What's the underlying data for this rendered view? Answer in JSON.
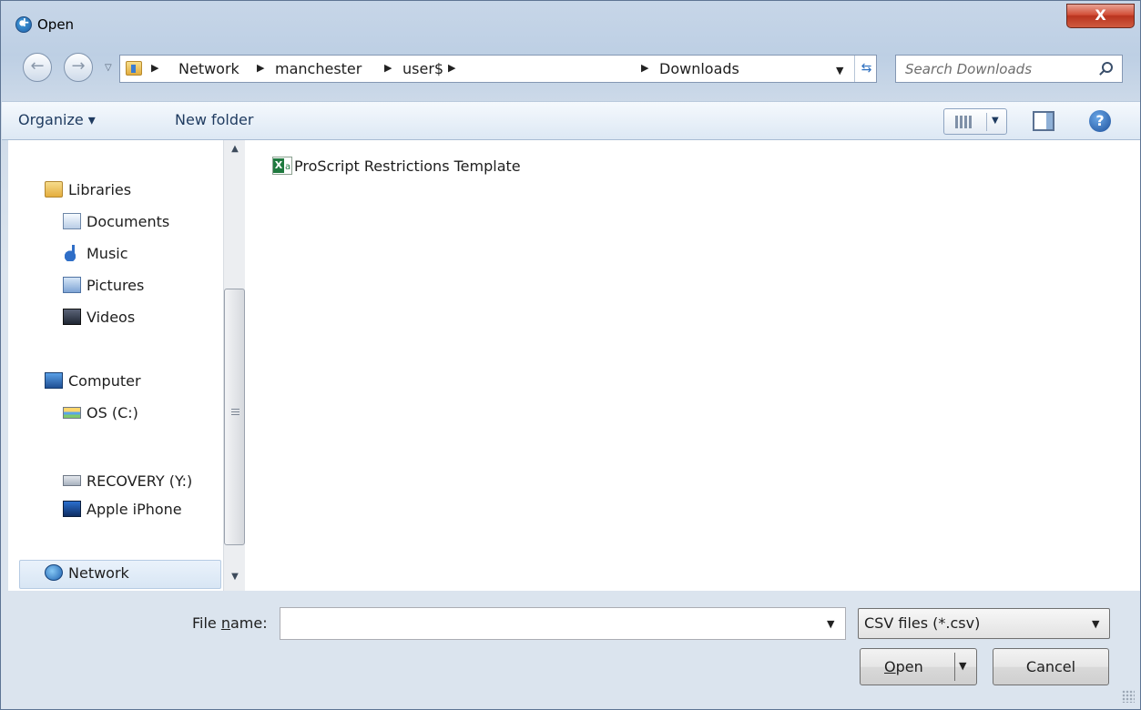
{
  "window": {
    "title": "Open",
    "close_label": "X"
  },
  "address_bar": {
    "crumbs": [
      "Network",
      "manchester",
      "user$",
      "Downloads"
    ]
  },
  "search": {
    "placeholder": "Search Downloads"
  },
  "toolbar": {
    "organize_label": "Organize ▾",
    "new_folder_label": "New folder"
  },
  "nav_pane": {
    "items": [
      {
        "label": "Libraries"
      },
      {
        "label": "Documents"
      },
      {
        "label": "Music"
      },
      {
        "label": "Pictures"
      },
      {
        "label": "Videos"
      },
      {
        "label": "Computer"
      },
      {
        "label": "OS (C:)"
      },
      {
        "label": "RECOVERY (Y:)"
      },
      {
        "label": "Apple iPhone"
      },
      {
        "label": "Network"
      }
    ]
  },
  "files": [
    {
      "name": "ProScript Restrictions Template",
      "type": "excel"
    }
  ],
  "file_name": {
    "label_prefix": "File ",
    "label_underlined": "n",
    "label_suffix": "ame:",
    "value": ""
  },
  "file_type_filter": {
    "selected": "CSV files (*.csv)"
  },
  "buttons": {
    "open_underlined": "O",
    "open_rest": "pen",
    "cancel_label": "Cancel"
  }
}
